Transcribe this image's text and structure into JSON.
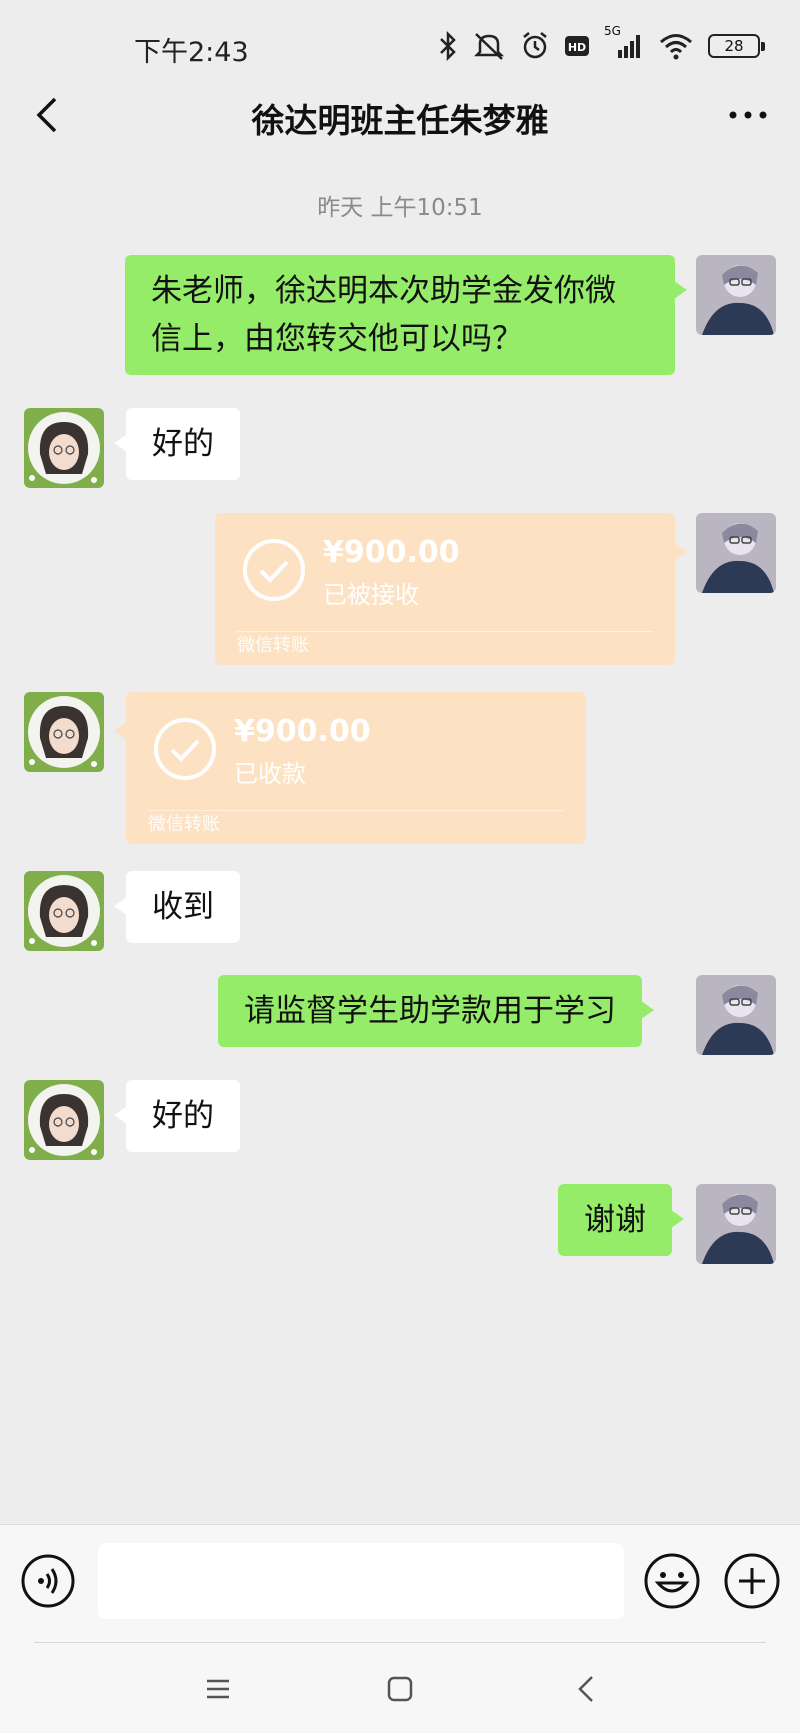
{
  "status_bar": {
    "time": "下午2:43",
    "network": "5G",
    "battery": "28"
  },
  "header": {
    "title": "徐达明班主任朱梦雅",
    "back_icon": "chevron-left-icon",
    "more_icon": "more-dots-icon"
  },
  "timestamp": "昨天 上午10:51",
  "messages": [
    {
      "side": "right",
      "type": "text",
      "lines": [
        "朱老师，徐达明本次助学金发你微",
        "信上，由您转交他可以吗？"
      ]
    },
    {
      "side": "left",
      "type": "text",
      "text": "好的"
    },
    {
      "side": "right",
      "type": "transfer",
      "amount": "¥900.00",
      "status": "已被接收",
      "label": "微信转账"
    },
    {
      "side": "left",
      "type": "transfer",
      "amount": "¥900.00",
      "status": "已收款",
      "label": "微信转账"
    },
    {
      "side": "left",
      "type": "text",
      "text": "收到"
    },
    {
      "side": "right",
      "type": "text",
      "text": "请监督学生助学款用于学习"
    },
    {
      "side": "left",
      "type": "text",
      "text": "好的"
    },
    {
      "side": "right",
      "type": "text",
      "text": "谢谢"
    }
  ],
  "input_bar": {
    "placeholder": "",
    "voice_icon": "voice-icon",
    "emoji_icon": "emoji-icon",
    "plus_icon": "plus-icon"
  },
  "colors": {
    "background": "#ededed",
    "sent_bubble": "#95ec69",
    "received_bubble": "#ffffff",
    "transfer_card": "#fde1c3"
  }
}
